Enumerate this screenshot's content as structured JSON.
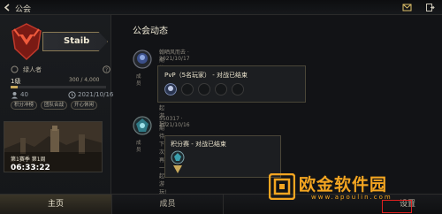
{
  "topbar": {
    "title": "公会",
    "icons": [
      "back-arrow-icon",
      "mail-icon",
      "exit-icon"
    ]
  },
  "profile": {
    "name": "Staib",
    "rank_name": "绿人者",
    "level_label": "1级",
    "exp_text": "300 / 4,000",
    "exp_progress": 0.075,
    "members": "40",
    "created": "2021/10/16",
    "pills": [
      "积分冲榜",
      "团队合战",
      "开心休闲"
    ]
  },
  "season": {
    "label": "第1赛季 第1周",
    "time": "06:33:22"
  },
  "feed": {
    "title": "公会动态",
    "items": [
      {
        "author": "翰晒风而去 · 2021/10/17",
        "sub": "期待下次再一起游玩!",
        "avatar_label": "成员",
        "card_title": "PvP（5名玩家） - 对战已结束"
      },
      {
        "author": "550317 · 2021/10/16",
        "sub": "期待下次再一起游玩!",
        "avatar_label": "成员",
        "card_title": "积分赛 - 对战已结束"
      }
    ]
  },
  "nav": {
    "home": "主页",
    "members": "成员",
    "settings": "设置"
  },
  "watermark": {
    "text": "欧金软件园",
    "url": "www.apoulin.com"
  },
  "colors": {
    "accent": "#c9a95b",
    "watermark": "#f3a521",
    "highlight": "#e02020"
  }
}
